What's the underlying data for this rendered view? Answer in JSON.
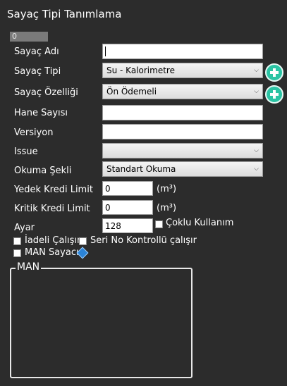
{
  "title": "Sayaç Tipi Tanımlama",
  "id_value": "0",
  "fields": {
    "ad": {
      "label": "Sayaç Adı",
      "value": ""
    },
    "tipi": {
      "label": "Sayaç Tipi",
      "value": "Su - Kalorimetre"
    },
    "ozellik": {
      "label": "Sayaç Özelliği",
      "value": "Ön Ödemeli"
    },
    "hane": {
      "label": "Hane Sayısı",
      "value": ""
    },
    "versiyon": {
      "label": "Versiyon",
      "value": ""
    },
    "issue": {
      "label": "Issue",
      "value": ""
    },
    "okuma": {
      "label": "Okuma Şekli",
      "value": "Standart Okuma"
    },
    "yedek": {
      "label": "Yedek Kredi Limit",
      "value": "0",
      "unit": "(m³)"
    },
    "kritik": {
      "label": "Kritik Kredi Limit",
      "value": "0",
      "unit": "(m³)"
    },
    "ayar": {
      "label": "Ayar",
      "value": "128"
    }
  },
  "checkboxes": {
    "coklu": {
      "label": "Çoklu Kullanım",
      "checked": false
    },
    "ideali": {
      "label": "İadeli Çalışır",
      "checked": false
    },
    "serino": {
      "label": "Seri No Kontrollü çalışır",
      "checked": false
    },
    "man": {
      "label": "MAN Sayacı",
      "checked": false
    }
  },
  "group": {
    "title": "MAN"
  },
  "icons": {
    "add": "plus-circle-icon",
    "info": "info-diamond-icon",
    "dropdown": "chevron-down-icon"
  },
  "colors": {
    "background": "#2c2c2c",
    "accent": "#2bc4a4",
    "info": "#2b84d8"
  }
}
